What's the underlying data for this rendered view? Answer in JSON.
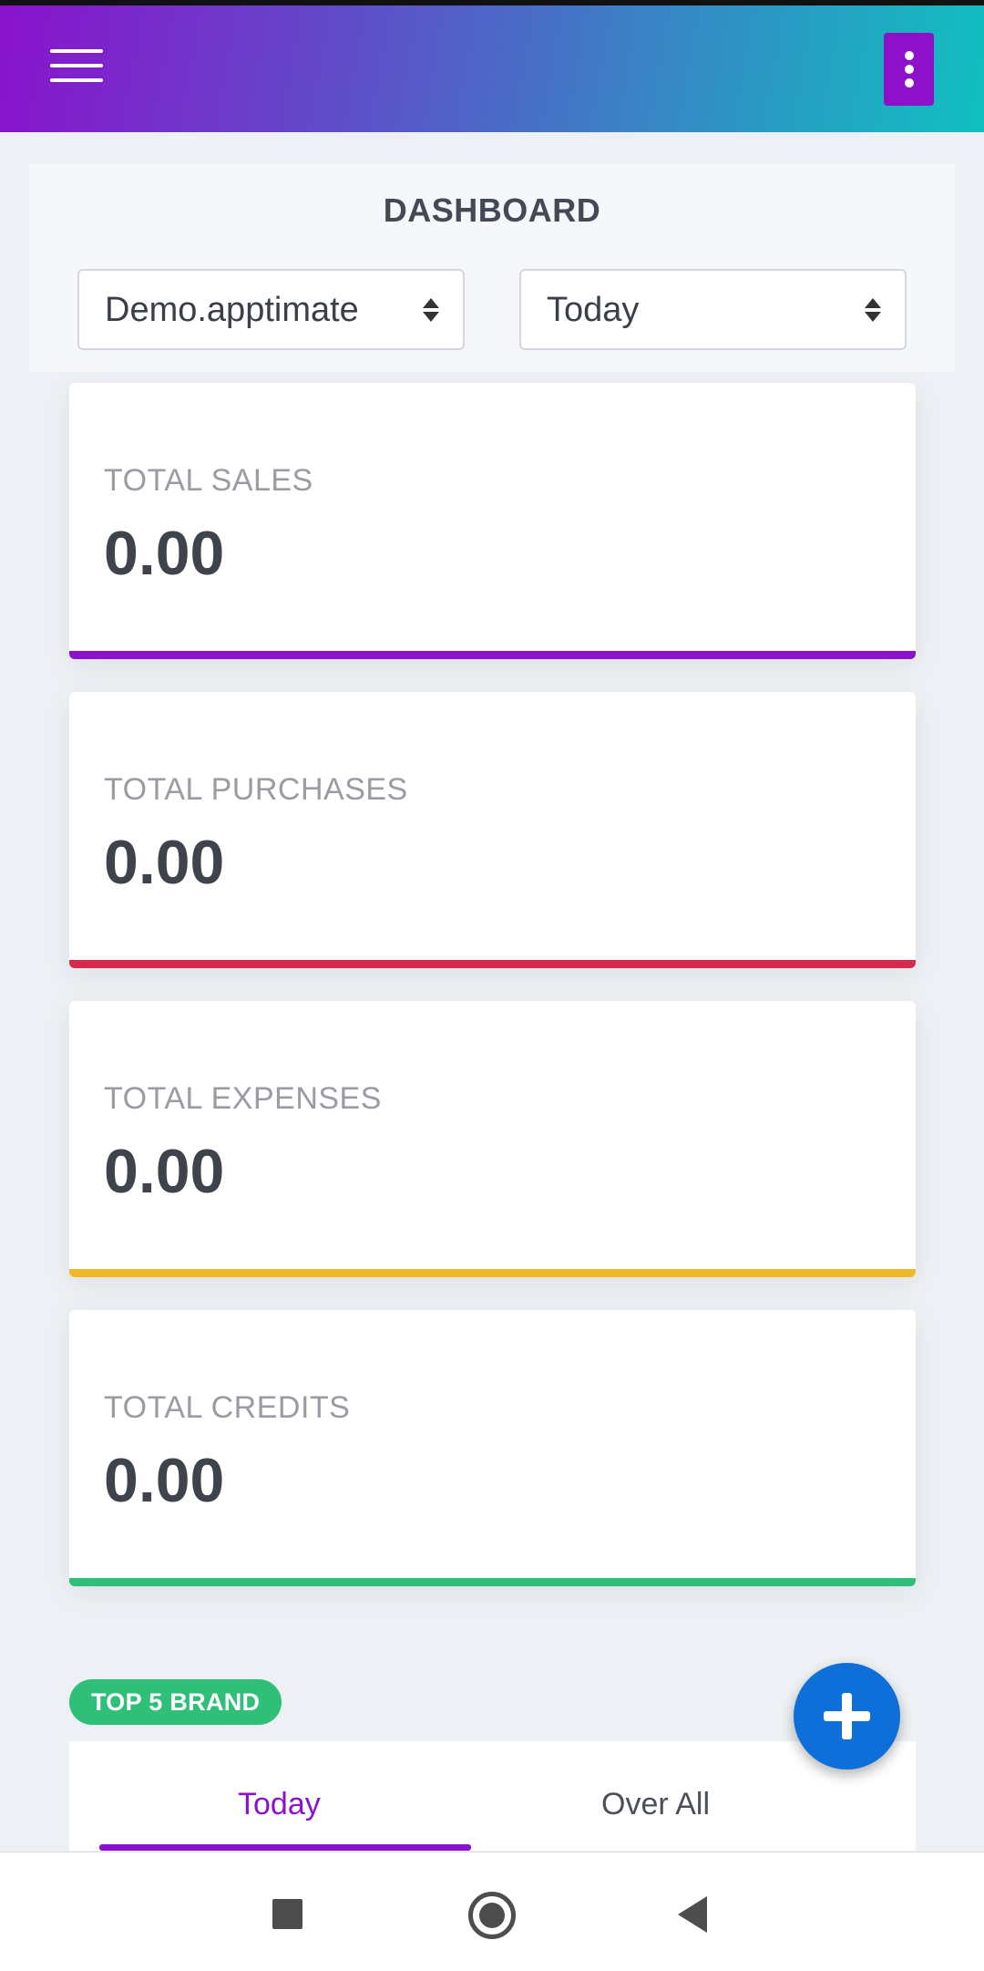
{
  "header": {
    "title": "DASHBOARD",
    "company_select": "Demo.apptimate",
    "period_select": "Today"
  },
  "stats": [
    {
      "label": "TOTAL SALES",
      "value": "0.00",
      "color": "#8a12cc"
    },
    {
      "label": "TOTAL PURCHASES",
      "value": "0.00",
      "color": "#d42a4e"
    },
    {
      "label": "TOTAL EXPENSES",
      "value": "0.00",
      "color": "#f0b92c"
    },
    {
      "label": "TOTAL CREDITS",
      "value": "0.00",
      "color": "#2fbf78"
    }
  ],
  "top_brand": {
    "badge": "TOP 5 BRAND",
    "tabs": [
      "Today",
      "Over All"
    ]
  },
  "icons": {
    "menu": "hamburger-menu-icon",
    "more": "more-vertical-icon",
    "fab": "plus-icon",
    "nav": [
      "recent-apps-icon",
      "home-icon",
      "back-icon"
    ]
  },
  "colors": {
    "accent": "#8a12cc",
    "fab": "#0f6fd8",
    "badge": "#2fbf78"
  }
}
